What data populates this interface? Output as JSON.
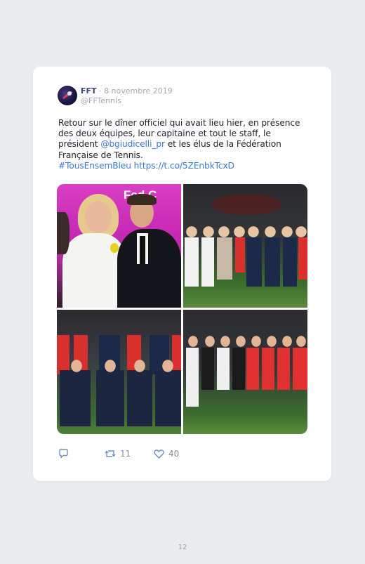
{
  "tweet": {
    "author_name": "FFT",
    "separator": " · ",
    "date": "8 novembre 2019",
    "handle": "@FFTennis",
    "text_part1": "Retour sur le dîner officiel qui avait lieu hier, en présence des deux équipes, leur capitaine et tout le staff, le président ",
    "mention": "@bgiudicelli_pr",
    "text_part2": " et les élus de la Fédération Française de Tennis.",
    "hashtag": "#TousEnsemBleu",
    "url": "https://t.co/5ZEnbkTcxD",
    "photos": [
      "photo-1",
      "photo-2",
      "photo-3",
      "photo-4"
    ],
    "backdrop_text": "Fed C"
  },
  "actions": {
    "reply_icon": "reply-icon",
    "retweet_icon": "retweet-icon",
    "retweet_count": "11",
    "like_icon": "heart-icon",
    "like_count": "40"
  },
  "page": {
    "number": "12"
  },
  "colors": {
    "link": "#3b7ad8",
    "author": "#3b4a7a",
    "card_bg": "#ffffff",
    "page_bg": "#e9ebee"
  }
}
